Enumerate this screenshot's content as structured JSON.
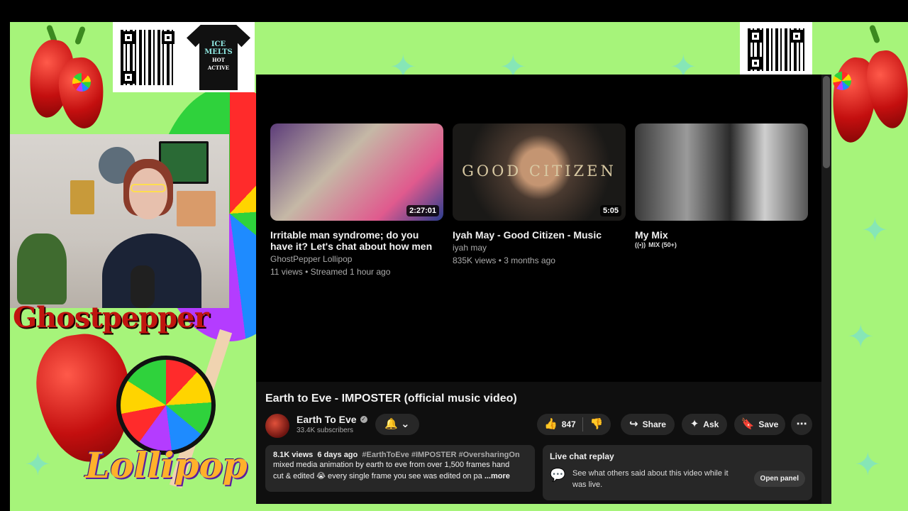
{
  "overlay": {
    "logo_title": "Ghostpepper",
    "logo_subtitle": "Lollipop",
    "merch_shirt_text": [
      "ICE",
      "MELTS",
      "HOT ACTIVE"
    ]
  },
  "endscreen": {
    "cards": [
      {
        "title": "Irritable man syndrome; do you have it? Let's chat about how men can be...",
        "channel": "GhostPepper Lollipop",
        "meta": "11 views • Streamed 1 hour ago",
        "duration": "2:27:01"
      },
      {
        "title": "Iyah May - Good Citizen - Music Video",
        "channel": "iyah may",
        "meta": "835K views • 3 months ago",
        "duration": "5:05",
        "thumb_text": "GOOD CITIZEN"
      },
      {
        "title": "My Mix",
        "badge": "MIX (50+)"
      }
    ]
  },
  "video": {
    "title": "Earth to Eve - IMPOSTER (official music video)",
    "channel": "Earth To Eve",
    "verified_mark": "✓",
    "subscribers": "33.4K subscribers",
    "likes": "847",
    "share_label": "Share",
    "ask_label": "Ask",
    "save_label": "Save"
  },
  "description": {
    "views": "8.1K views",
    "age": "6 days ago",
    "tags": "#EarthToEve #IMPOSTER #OversharingOn",
    "line1": "mixed media animation by earth to eve from over 1,500 frames hand",
    "line2": "cut & edited 😭 every single frame you see was edited on pa",
    "more": "...more"
  },
  "live_chat": {
    "title": "Live chat replay",
    "text": "See what others said about this video while it was live.",
    "button": "Open panel"
  },
  "icons": {
    "bell": "🔔",
    "chevron": "⌄",
    "like": "👍",
    "dislike": "👎",
    "share": "↪",
    "ask": "✦",
    "save": "🔖",
    "more": "⋯",
    "chat": "💬",
    "mix": "((•))"
  },
  "colors": {
    "overlay_green": "#a6f47a",
    "yt_bg": "#0f0f0f",
    "pill_bg": "#272727"
  }
}
